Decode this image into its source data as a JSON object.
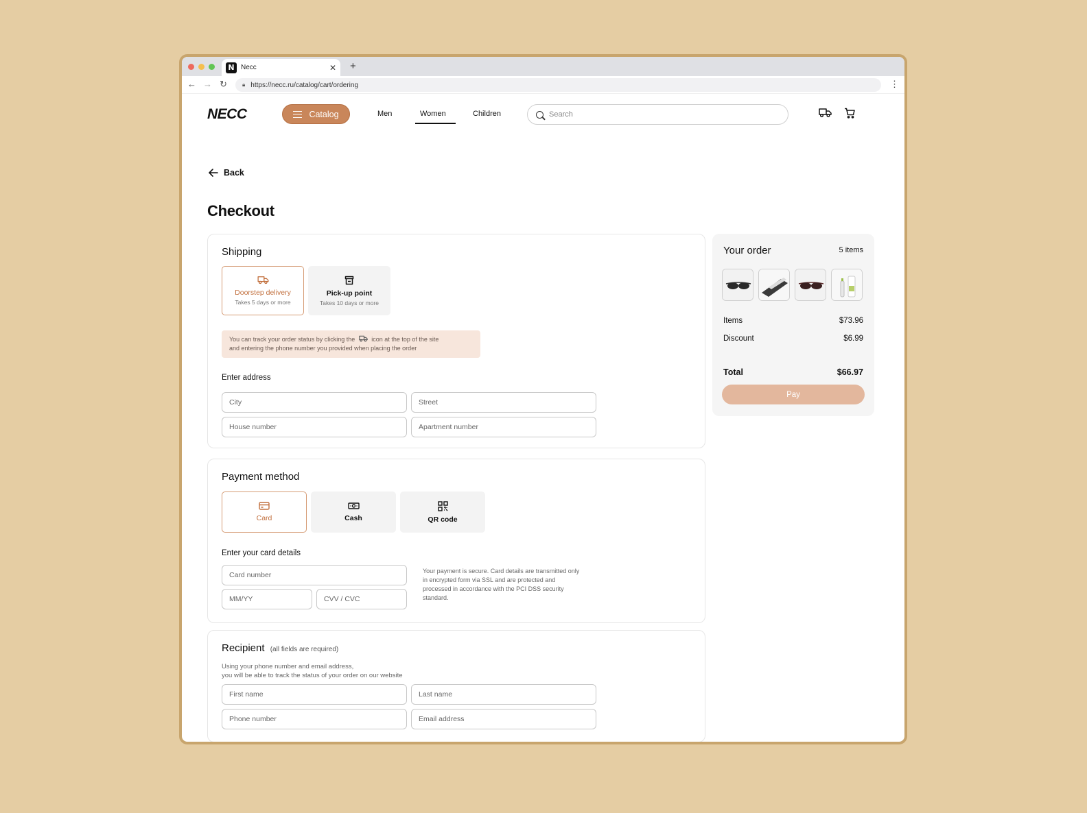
{
  "browser": {
    "tab_title": "Necc",
    "favicon_letter": "N",
    "url": "https://necc.ru/catalog/cart/ordering"
  },
  "header": {
    "logo": "NECC",
    "catalog_label": "Catalog",
    "nav": [
      "Men",
      "Women",
      "Children"
    ],
    "active_nav": "Women",
    "search_placeholder": "Search"
  },
  "back_label": "Back",
  "page_title": "Checkout",
  "shipping": {
    "title": "Shipping",
    "options": [
      {
        "label": "Doorstep delivery",
        "sub": "Takes 5 days or more",
        "selected": true
      },
      {
        "label": "Pick-up point",
        "sub": "Takes 10 days or more",
        "selected": false
      }
    ],
    "notice_part1": "You can track your order status by clicking the",
    "notice_part2": "icon at the top of the site",
    "notice_line2": "and entering the phone number you provided when placing the order",
    "address_label": "Enter address",
    "fields": {
      "city": "City",
      "street": "Street",
      "house": "House number",
      "apartment": "Apartment number"
    }
  },
  "payment": {
    "title": "Payment method",
    "options": [
      {
        "label": "Card",
        "selected": true
      },
      {
        "label": "Cash",
        "selected": false
      },
      {
        "label": "QR code",
        "selected": false
      }
    ],
    "card_label": "Enter your card details",
    "fields": {
      "card_number": "Card number",
      "expiry": "MM/YY",
      "cvv": "CVV / CVC"
    },
    "secure_text": "Your payment is secure. Card details are transmitted only in encrypted form via SSL and are protected and processed in accordance with the PCI DSS security standard."
  },
  "recipient": {
    "title": "Recipient",
    "note": "(all fields are required)",
    "desc_line1": "Using your phone number and email address,",
    "desc_line2": "you will be able to track the status of your order on our website",
    "fields": {
      "first_name": "First name",
      "last_name": "Last name",
      "phone": "Phone number",
      "email": "Email address"
    }
  },
  "order": {
    "title": "Your order",
    "count": "5 items",
    "thumbnails": [
      "sunglasses-thumb",
      "eyewear-case-thumb",
      "sunglasses-thumb",
      "cleaning-spray-thumb"
    ],
    "items_label": "Items",
    "items_value": "$73.96",
    "discount_label": "Discount",
    "discount_value": "$6.99",
    "total_label": "Total",
    "total_value": "$66.97",
    "pay_label": "Pay"
  },
  "colors": {
    "background": "#e5cda3",
    "accent": "#c9865a",
    "accent_text": "#c2703e",
    "pay_button": "#e3b79d",
    "notice_bg": "#f7e6dc"
  }
}
